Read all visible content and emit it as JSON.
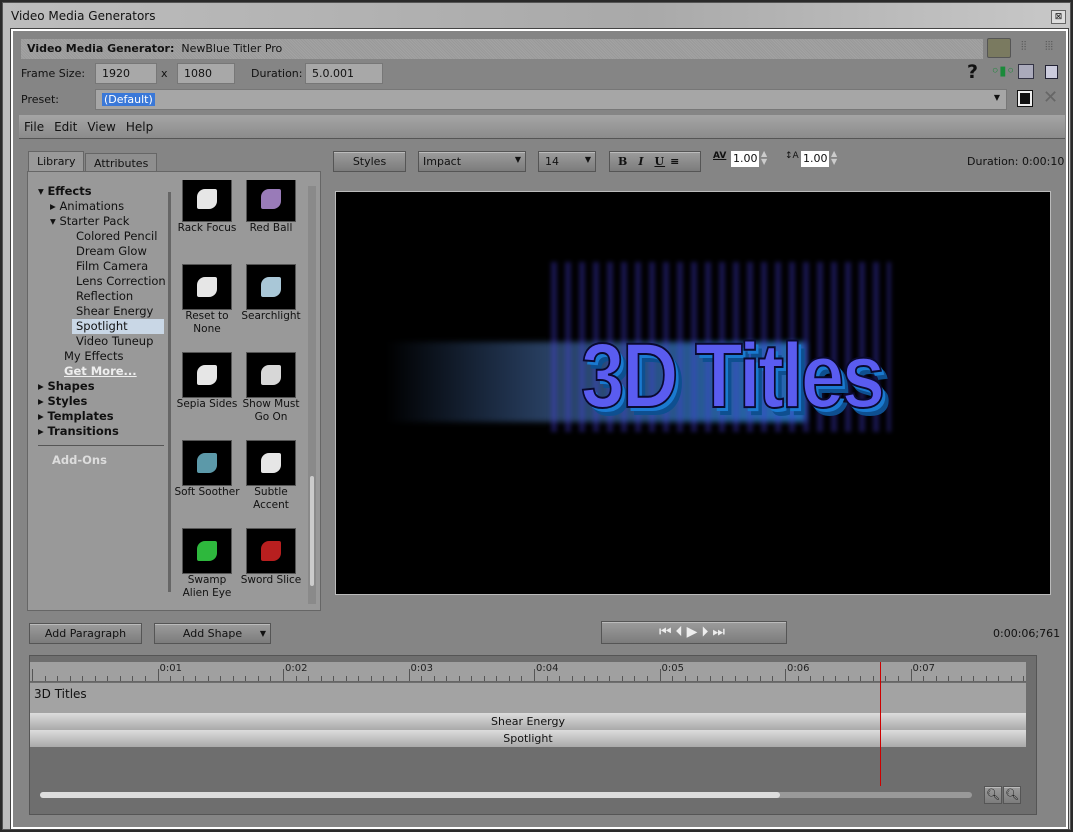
{
  "window": {
    "title": "Video Media Generators",
    "close": "⊠"
  },
  "header": {
    "label": "Video Media Generator:",
    "value": "NewBlue Titler Pro"
  },
  "frame": {
    "label": "Frame Size:",
    "width": "1920",
    "x": "x",
    "height": "1080",
    "duration_label": "Duration:",
    "duration": "5.0.001"
  },
  "preset": {
    "label": "Preset:",
    "value": "(Default)"
  },
  "menu": [
    "File",
    "Edit",
    "View",
    "Help"
  ],
  "tabs": [
    "Library",
    "Attributes"
  ],
  "tree": {
    "effects": "Effects",
    "animations": "Animations",
    "starter": "Starter Pack",
    "items": [
      "Colored Pencil",
      "Dream Glow",
      "Film Camera",
      "Lens Correction",
      "Reflection",
      "Shear Energy",
      "Spotlight",
      "Video Tuneup"
    ],
    "my": "My Effects",
    "get": "Get More...",
    "shapes": "Shapes",
    "styles": "Styles",
    "templates": "Templates",
    "transitions": "Transitions",
    "addons": "Add-Ons"
  },
  "thumbs": [
    "Rack Focus",
    "Red Ball",
    "Reset to None",
    "Searchlight",
    "Sepia Sides",
    "Show Must Go On",
    "Soft Soother",
    "Subtle Accent",
    "Swamp Alien Eye",
    "Sword Slice"
  ],
  "toolbar": {
    "styles": "Styles",
    "font": "Impact",
    "size": "14",
    "bold": "B",
    "italic": "I",
    "underline": "U",
    "kerning": "1.00",
    "leading": "1.00",
    "duration": "Duration: 0:00:10"
  },
  "preview": {
    "text": "3D Titles"
  },
  "buttons": {
    "add_paragraph": "Add Paragraph",
    "add_shape": "Add Shape"
  },
  "timecode": "0:00:06;761",
  "timeline": {
    "ticks": [
      "0:01",
      "0:02",
      "0:03",
      "0:04",
      "0:05",
      "0:06",
      "0:07"
    ],
    "track": "3D Titles",
    "effects": [
      "Shear Energy",
      "Spotlight"
    ],
    "playhead_seconds": 6.76
  }
}
